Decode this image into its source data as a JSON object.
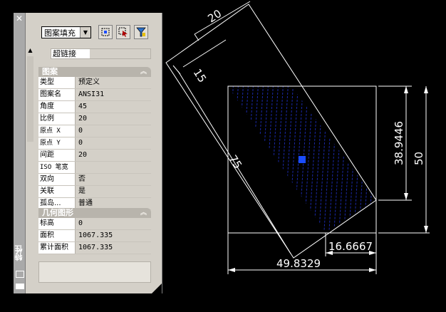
{
  "palette": {
    "title": "特性",
    "object_type": "图案填充",
    "hyperlink_label": "超链接",
    "sections": [
      {
        "title": "图案",
        "rows": [
          {
            "key": "类型",
            "value": "预定义"
          },
          {
            "key": "图案名",
            "value": "ANSI31"
          },
          {
            "key": "角度",
            "value": "45"
          },
          {
            "key": "比例",
            "value": "20"
          },
          {
            "key": "原点 X",
            "value": "0"
          },
          {
            "key": "原点 Y",
            "value": "0"
          },
          {
            "key": "间距",
            "value": "20"
          },
          {
            "key": "ISO 笔宽",
            "value": ""
          },
          {
            "key": "双向",
            "value": "否"
          },
          {
            "key": "关联",
            "value": "是"
          },
          {
            "key": "孤岛...",
            "value": "普通"
          }
        ]
      },
      {
        "title": "几何图形",
        "rows": [
          {
            "key": "标高",
            "value": "0"
          },
          {
            "key": "面积",
            "value": "1067.335"
          },
          {
            "key": "累计面积",
            "value": "1067.335"
          }
        ]
      }
    ],
    "toolbar_icons": [
      "quick-select-icon",
      "select-objects-icon",
      "toggle-pickadd-icon"
    ]
  },
  "drawing": {
    "dimensions": {
      "dim_20": "20",
      "dim_15": "15",
      "dim_75": "75",
      "dim_38": "38.9446",
      "dim_50": "50",
      "dim_16": "16.6667",
      "dim_49": "49.8329"
    },
    "colors": {
      "lines": "#ffffff",
      "hatch": "#1b2aa8",
      "grip": "#1a4cff",
      "background": "#000000"
    }
  }
}
